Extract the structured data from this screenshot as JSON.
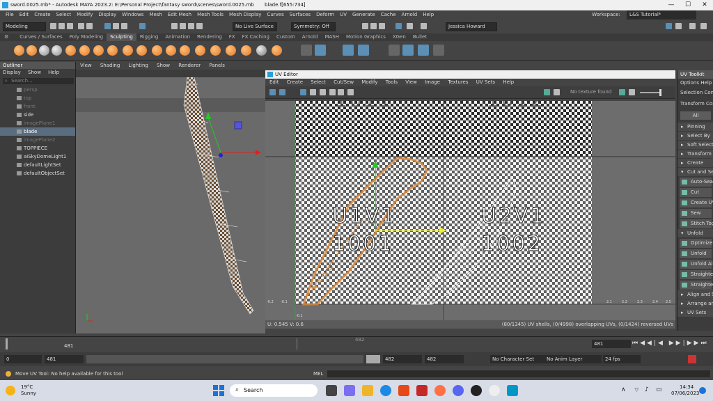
{
  "window": {
    "title": "sword.0025.mb* - Autodesk MAYA 2023.2: E:\\Personal Project\\fantasy sword\\scenes\\sword.0025.mb",
    "selection": "blade.f[655:734]"
  },
  "menu": [
    "File",
    "Edit",
    "Create",
    "Select",
    "Modify",
    "Display",
    "Windows",
    "Mesh",
    "Edit Mesh",
    "Mesh Tools",
    "Mesh Display",
    "Curves",
    "Surfaces",
    "Deform",
    "UV",
    "Generate",
    "Cache",
    "Arnold",
    "Help"
  ],
  "workspace": {
    "label": "Workspace:",
    "value": "L&S Tutorial*"
  },
  "toolbar": {
    "mode": "Modeling",
    "live_surface": "No Live Surface",
    "symmetry": "Symmetry: Off",
    "user": "Jessica Howard"
  },
  "shelf_tabs": [
    "Curves / Surfaces",
    "Poly Modeling",
    "Sculpting",
    "Rigging",
    "Animation",
    "Rendering",
    "FX",
    "FX Caching",
    "Custom",
    "Arnold",
    "MASH",
    "Motion Graphics",
    "XGen",
    "Bullet"
  ],
  "shelf_active": "Sculpting",
  "outliner": {
    "title": "Outliner",
    "menu": [
      "Display",
      "Show",
      "Help"
    ],
    "search_placeholder": "Search...",
    "items": [
      {
        "label": "persp",
        "dim": true
      },
      {
        "label": "top",
        "dim": true
      },
      {
        "label": "front",
        "dim": true
      },
      {
        "label": "side",
        "dim": false
      },
      {
        "label": "imagePlane1",
        "dim": true
      },
      {
        "label": "blade",
        "dim": false,
        "selected": true
      },
      {
        "label": "imagePlane2",
        "dim": true
      },
      {
        "label": "TOPPIECE",
        "dim": false
      },
      {
        "label": "aiSkyDomeLight1",
        "dim": false
      },
      {
        "label": "defaultLightSet",
        "dim": false
      },
      {
        "label": "defaultObjectSet",
        "dim": false
      }
    ]
  },
  "viewport": {
    "menu": [
      "View",
      "Shading",
      "Lighting",
      "Show",
      "Renderer",
      "Panels"
    ]
  },
  "uv_editor": {
    "title": "UV Editor",
    "menu": [
      "Edit",
      "Create",
      "Select",
      "Cut/Sew",
      "Modify",
      "Tools",
      "View",
      "Image",
      "Textures",
      "UV Sets",
      "Help"
    ],
    "texture": "No texture found",
    "tiles": [
      {
        "name": "U1V1",
        "udim": "1001"
      },
      {
        "name": "U2V1",
        "udim": "1002"
      }
    ],
    "top_tiles": [
      "1011",
      "1012"
    ],
    "ruler_left": [
      "-0.2",
      "-0.1"
    ],
    "ruler_right": [
      "2.1",
      "2.2",
      "2.3",
      "2.4",
      "2.5"
    ],
    "ruler_v": "-0.1",
    "coords": "U: 0.545  V: 0.6",
    "status": "(80/1345) UV shells, (0/4998) overlapping UVs, (0/1424) reversed UVs"
  },
  "uv_toolkit": {
    "title": "UV Toolkit",
    "menu": [
      "Options",
      "Help"
    ],
    "rows": [
      "Selection Constraint",
      "Transform Constraint"
    ],
    "all_button": "All",
    "sections": [
      {
        "label": "Pinning",
        "open": false
      },
      {
        "label": "Select By",
        "open": false
      },
      {
        "label": "Soft Selection",
        "open": false
      },
      {
        "label": "Transform",
        "open": false
      },
      {
        "label": "Create",
        "open": false
      },
      {
        "label": "Cut and Sew",
        "open": true,
        "buttons": [
          "Auto-Seams",
          "Cut",
          "Create UV Shell",
          "Sew",
          "Stitch Together"
        ]
      },
      {
        "label": "Unfold",
        "open": true,
        "buttons": [
          "Optimize",
          "Unfold",
          "Unfold Along",
          "Straighten UVs",
          "Straighten Shell"
        ]
      },
      {
        "label": "Align and Snap",
        "open": false
      },
      {
        "label": "Arrange and Layout",
        "open": false
      },
      {
        "label": "UV Sets",
        "open": false
      }
    ]
  },
  "timeline": {
    "current": "481",
    "marker": "482",
    "frame_field": "481"
  },
  "range": {
    "start": "0",
    "start_inner": "481",
    "end_inner": "482",
    "end": "482",
    "character_set": "No Character Set",
    "anim_layer": "No Anim Layer",
    "fps": "24 fps"
  },
  "help_line": "Move UV Tool: No help available for this tool",
  "mel": "MEL",
  "taskbar": {
    "temp": "19°C",
    "weather": "Sunny",
    "search": "Search",
    "time": "14:34",
    "date": "07/06/2023"
  },
  "colors": {
    "accent": "#5a6d80",
    "orange": "#e0782a",
    "checker_dark": "#2b2b2b",
    "checker_light": "#f0f0f0"
  }
}
